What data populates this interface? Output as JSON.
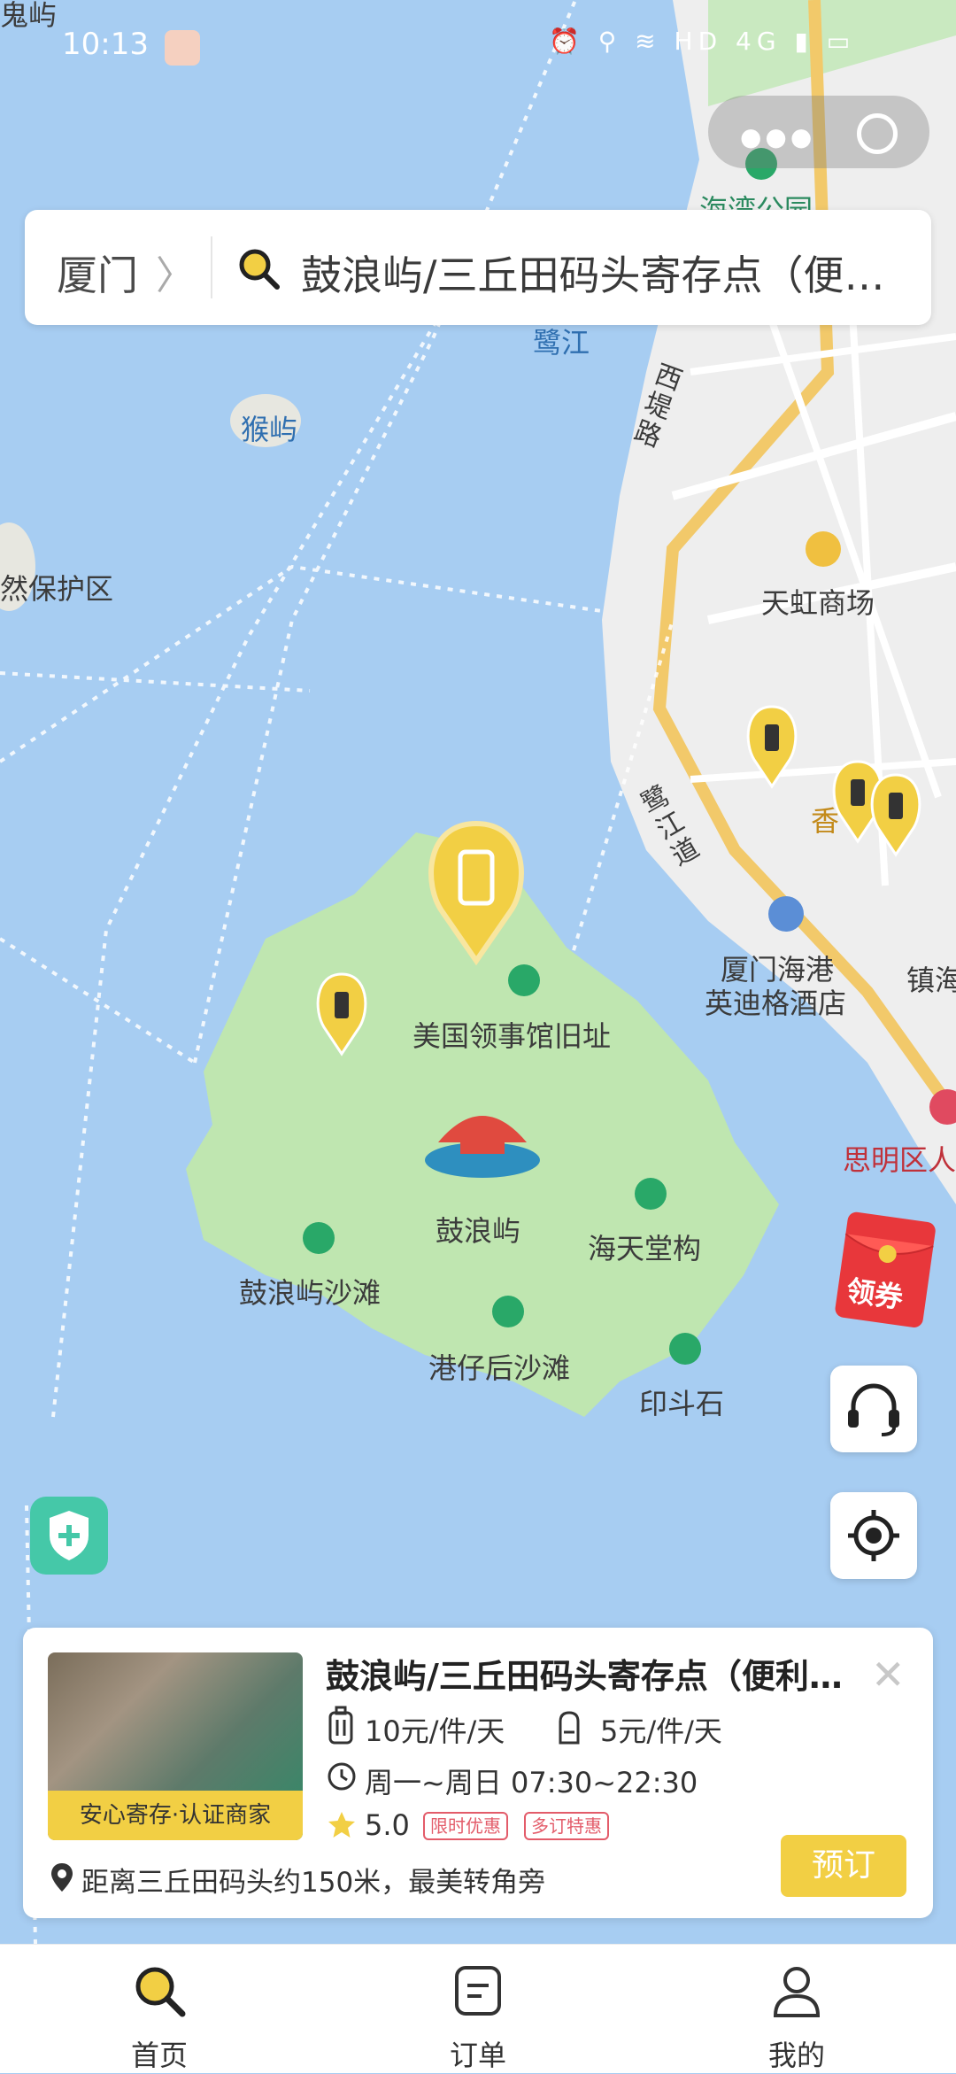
{
  "status_bar": {
    "time": "10:13",
    "icons": "⏰ ⚲ ≋ HD 4G ▮ ▭"
  },
  "map": {
    "labels": {
      "gulangyu": "鼓浪屿",
      "consulate": "美国领事馆旧址",
      "haitian": "海天堂构",
      "beach": "鼓浪屿沙滩",
      "gangzaihou": "港仔后沙滩",
      "yindou": "印斗石",
      "houyu": "猴屿",
      "lujiang": "鹭江",
      "baohuqu": "然保护区",
      "tianhong": "天虹商场",
      "xidi": "西堤路",
      "lujiangdao": "鹭江道",
      "hotel1": "厦门海港",
      "hotel2": "英迪格酒店",
      "siming": "思明区人",
      "zhen": "镇海",
      "park": "海湾公园",
      "xiang": "香",
      "tuyu": "鬼屿"
    }
  },
  "search": {
    "city": "厦门",
    "chevron": "〉",
    "query": "鼓浪屿/三丘田码头寄存点（便利店）"
  },
  "coupon": {
    "label": "领券"
  },
  "card": {
    "title": "鼓浪屿/三丘田码头寄存点（便利店）",
    "badge": "安心寄存·认证商家",
    "price_large": "10元/件/天",
    "price_small": "5元/件/天",
    "hours": "周一~周日 07:30~22:30",
    "rating": "5.0",
    "tags": [
      "限时优惠",
      "多订特惠"
    ],
    "address": "距离三丘田码头约150米，最美转角旁",
    "book": "预订",
    "close": "✕"
  },
  "tabs": [
    {
      "label": "首页",
      "icon": "search-icon"
    },
    {
      "label": "订单",
      "icon": "order-icon"
    },
    {
      "label": "我的",
      "icon": "user-icon"
    }
  ],
  "colors": {
    "accent": "#f2cf44",
    "water": "#a7cdf2",
    "land": "#bfe6b0",
    "city": "#eeeeee"
  }
}
